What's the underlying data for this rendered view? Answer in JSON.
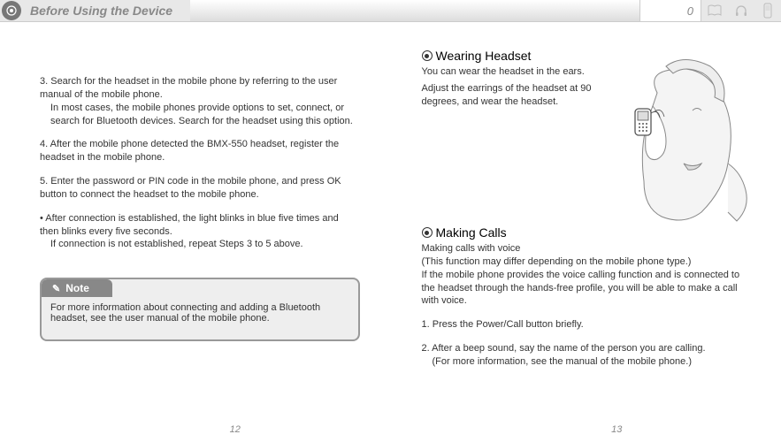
{
  "header": {
    "title": "Before Using the Device",
    "page_indicator": "0",
    "icon_left": "device-icon",
    "icon_book": "book-icon",
    "icon_headphones": "headphones-icon",
    "icon_phone": "phone-icon"
  },
  "left": {
    "step3": "3. Search for the headset in the mobile phone by referring to the user manual of the mobile phone.",
    "step3b": "In most cases, the mobile phones provide options to set, connect, or search for Bluetooth devices.  Search for the headset using this option.",
    "step4": "4. After the mobile phone detected the BMX-550 headset, register the headset in the mobile phone.",
    "step5": "5. Enter the password or PIN code in the mobile phone, and press OK button to connect the headset to the mobile phone.",
    "after": " • After connection is established, the light blinks in blue five times and then blinks every five seconds.",
    "after2": "If connection is not established, repeat Steps 3 to 5 above.",
    "note_label": "Note",
    "note_body": "For more information about connecting and adding a Bluetooth headset, see the user manual of the mobile phone.",
    "page_num": "12"
  },
  "right": {
    "wearing_title": "Wearing Headset",
    "wearing_text1": "You can wear the headset in the ears.",
    "wearing_text2": "Adjust the earrings of the headset at 90 degrees, and wear the headset.",
    "making_title": "Making Calls",
    "making_sub": "Making calls with voice",
    "making_p1": "(This function may differ depending on the mobile phone type.)",
    "making_p2": "If the mobile phone provides the voice calling function and is connected to the headset through the hands-free profile, you will be able to make a call with voice.",
    "step1": "1. Press the Power/Call button briefly.",
    "step2": "2. After a beep sound, say the name of the person you are calling.",
    "step2b": "(For more information, see the manual of the mobile phone.)",
    "page_num": "13"
  }
}
